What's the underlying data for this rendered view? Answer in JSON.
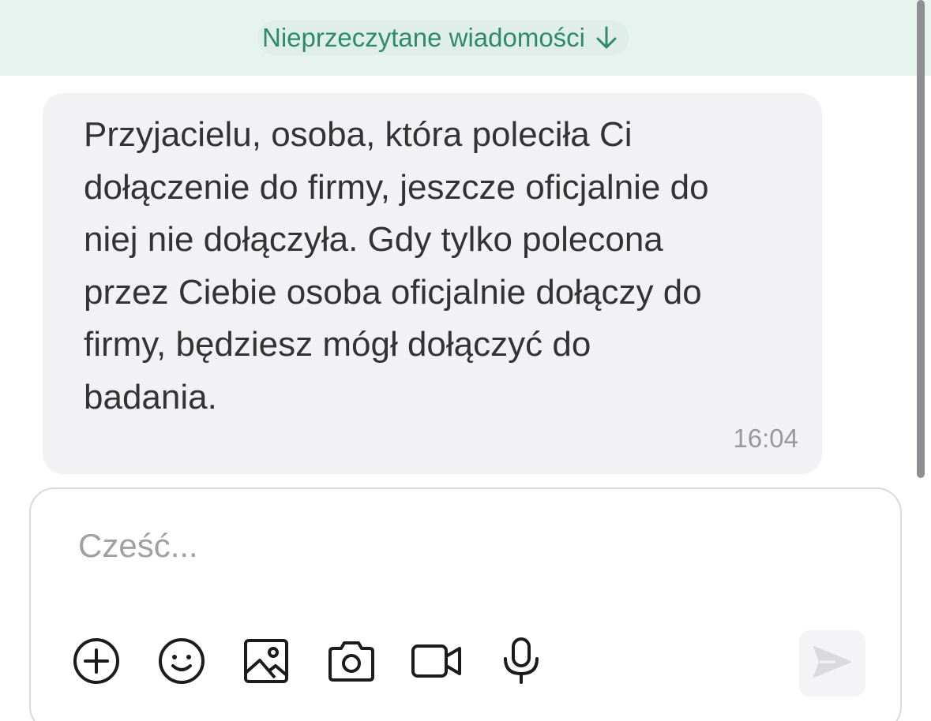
{
  "banner": {
    "label": "Nieprzeczytane wiadomości",
    "arrow_icon": "arrow-down-icon",
    "color": "#2f8a6c"
  },
  "message": {
    "text": "Przyjacielu, osoba, która poleciła Ci\ndołączenie do firmy, jeszcze oficjalnie do\nniej nie dołączyła. Gdy tylko polecona\nprzez Ciebie osoba oficjalnie dołączy do\nfirmy, będziesz mógł dołączyć do\nbadania.",
    "time": "16:04"
  },
  "composer": {
    "placeholder": "Cześć...",
    "value": "",
    "tools": [
      "add-icon",
      "emoji-icon",
      "image-icon",
      "camera-icon",
      "video-icon",
      "microphone-icon"
    ],
    "send_icon": "send-icon"
  }
}
